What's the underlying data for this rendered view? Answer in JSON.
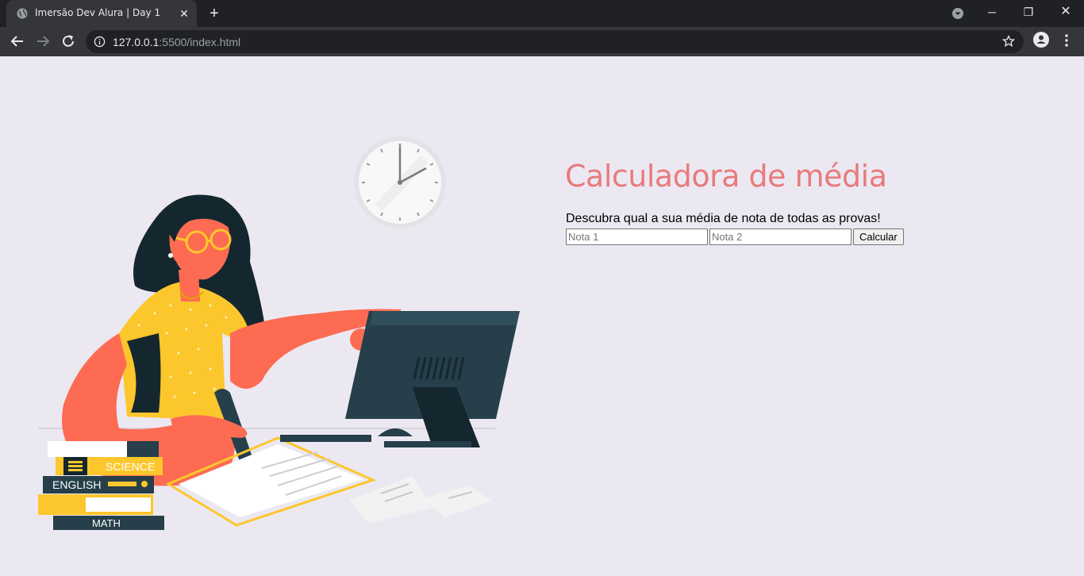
{
  "browser": {
    "tab_title": "Imersão Dev Alura | Day 1",
    "url_host": "127.0.0.1",
    "url_rest": ":5500/index.html"
  },
  "page": {
    "title": "Calculadora de média",
    "subtitle": "Descubra qual a sua média de nota de todas as provas!",
    "nota1_placeholder": "Nota 1",
    "nota2_placeholder": "Nota 2",
    "calc_label": "Calcular"
  },
  "illustration": {
    "books": [
      "SCIENCE",
      "ENGLISH",
      "MATH"
    ]
  },
  "colors": {
    "background": "#ece8f2",
    "title": "#e87b7b",
    "chrome_dark": "#202124",
    "chrome_toolbar": "#35363a",
    "shirt": "#fcc72c",
    "skin": "#fd6b53",
    "monitor": "#263f4a"
  }
}
